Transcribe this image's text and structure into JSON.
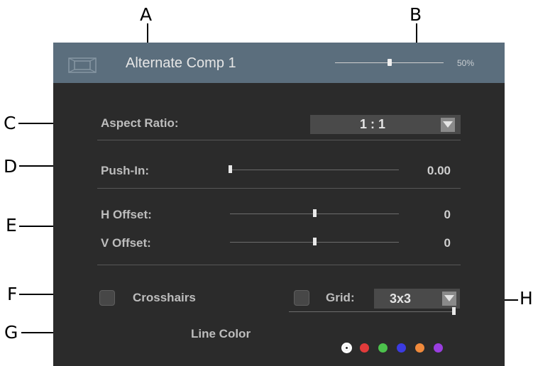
{
  "callouts": {
    "a": "A",
    "b": "B",
    "c": "C",
    "d": "D",
    "e": "E",
    "f": "F",
    "g": "G",
    "h": "H"
  },
  "header": {
    "icon": "frame-icon",
    "title": "Alternate Comp 1",
    "opacity_value": 0.5,
    "opacity_label": "50%"
  },
  "aspect_ratio": {
    "label": "Aspect Ratio:",
    "value": "1 : 1",
    "arrow_icon": "chevron-down-icon"
  },
  "push_in": {
    "label": "Push-In:",
    "value": "0.00",
    "level": 0.0
  },
  "offsets": {
    "h_label": "H Offset:",
    "h_value": "0",
    "h_level": 0.5,
    "v_label": "V Offset:",
    "v_value": "0",
    "v_level": 0.5
  },
  "crosshairs": {
    "label": "Crosshairs",
    "checked": false
  },
  "grid": {
    "label": "Grid:",
    "checked": false,
    "value": "3x3",
    "arrow_icon": "chevron-down-icon"
  },
  "line_color": {
    "label": "Line Color",
    "level": 1.0,
    "swatches": [
      "#ffffff",
      "#e23b3b",
      "#4cc24c",
      "#3b3be2",
      "#f08a3c",
      "#9a3ee0"
    ],
    "selected_index": 0
  },
  "colors": {
    "panel_bg": "#2b2b2b",
    "header_bg": "#5b6e7d",
    "dropdown_bg": "#4a4a4a"
  }
}
